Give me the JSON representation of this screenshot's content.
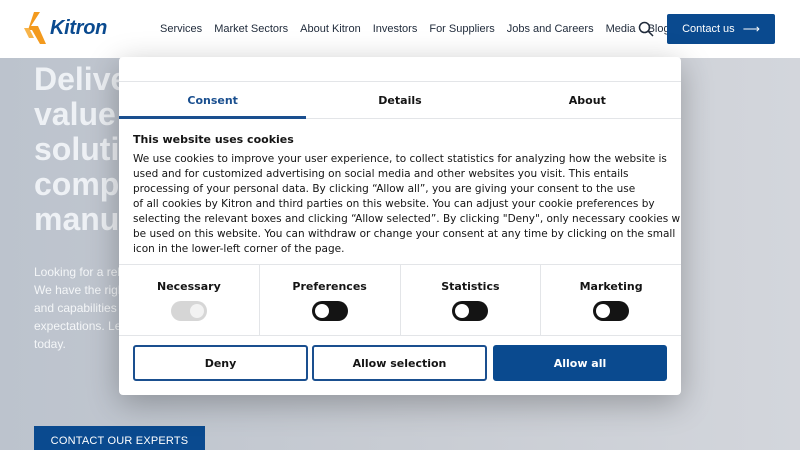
{
  "header": {
    "logo_text": "Kitron",
    "nav": [
      "Services",
      "Market Sectors",
      "About Kitron",
      "Investors",
      "For Suppliers",
      "Jobs and Careers",
      "Media",
      "Blog"
    ],
    "contact_label": "Contact us",
    "contact_arrow": "⟶"
  },
  "hero": {
    "title_lines": [
      "Delive",
      "value",
      "soluti",
      "comp",
      "manu"
    ],
    "text_lines": [
      "Looking for a reli",
      "We have the righ",
      "and capabilities",
      "expectations. Le",
      "today."
    ],
    "cta_label": "CONTACT OUR EXPERTS"
  },
  "cookie": {
    "tabs": [
      "Consent",
      "Details",
      "About"
    ],
    "title": "This website uses cookies",
    "text_lines": [
      "We use cookies to improve your user experience, to collect statistics for analyzing how the website is",
      "used and for customized advertising on social media and other websites you visit. This entails",
      "processing of your personal data. By clicking “Allow all”, you are giving your consent to the use",
      "of all cookies by Kitron and third parties on this website. You can adjust your cookie preferences by",
      "selecting the relevant boxes and clicking “Allow selected”. By clicking \"Deny\", only necessary cookies will",
      "be used on this website. You can withdraw or change your consent at any time by clicking on the small",
      "icon in the lower-left corner of the page."
    ],
    "toggles": [
      {
        "label": "Necessary",
        "state": "on-disabled"
      },
      {
        "label": "Preferences",
        "state": "off"
      },
      {
        "label": "Statistics",
        "state": "off"
      },
      {
        "label": "Marketing",
        "state": "off"
      }
    ],
    "buttons": {
      "deny": "Deny",
      "allow_selection": "Allow selection",
      "allow_all": "Allow all"
    }
  },
  "colors": {
    "brand_blue": "#0a4a8f",
    "accent_blue": "#1a4f8f",
    "logo_orange": "#f39a1e"
  }
}
